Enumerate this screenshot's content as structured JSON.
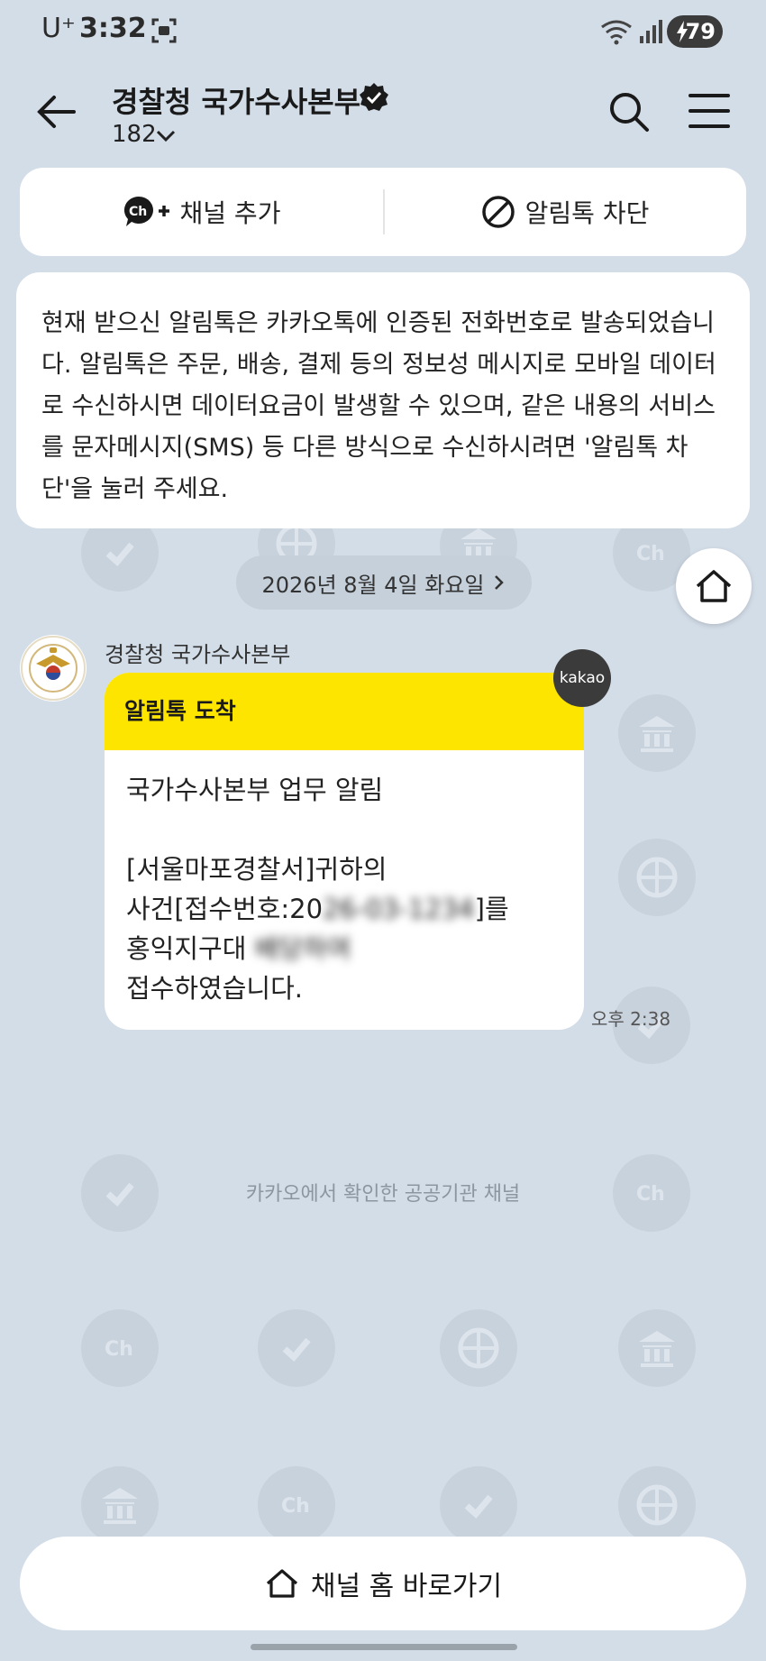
{
  "status_bar": {
    "carrier": "U⁺",
    "time": "3:32",
    "battery": "79"
  },
  "header": {
    "title": "경찰청 국가수사본부",
    "count": "182"
  },
  "actions": {
    "add_channel": "채널 추가",
    "block": "알림톡 차단"
  },
  "notice": {
    "text": "현재 받으신 알림톡은 카카오톡에 인증된 전화번호로 발송되었습니다. 알림톡은 주문, 배송, 결제 등의 정보성 메시지로 모바일 데이터로 수신하시면 데이터요금이 발생할 수 있으며, 같은 내용의 서비스를 문자메시지(SMS) 등 다른 방식으로 수신하시려면 '알림톡 차단'을 눌러 주세요."
  },
  "date_chip": "2026년 8월 4일 화요일",
  "message": {
    "sender": "경찰청 국가수사본부",
    "header": "알림톡 도착",
    "line1": "국가수사본부 업무 알림",
    "line2": "[서울마포경찰서]귀하의",
    "line3a": "사건[접수번호:20",
    "line3b": "26-03-1234",
    "line3c": "]를",
    "line4a": "홍익지구대 ",
    "line4b": "배당하여",
    "line5": "접수하였습니다.",
    "time": "오후 2:38",
    "badge": "kakao"
  },
  "footnote": "카카오에서 확인한 공공기관 채널",
  "bottom_button": "채널 홈 바로가기"
}
